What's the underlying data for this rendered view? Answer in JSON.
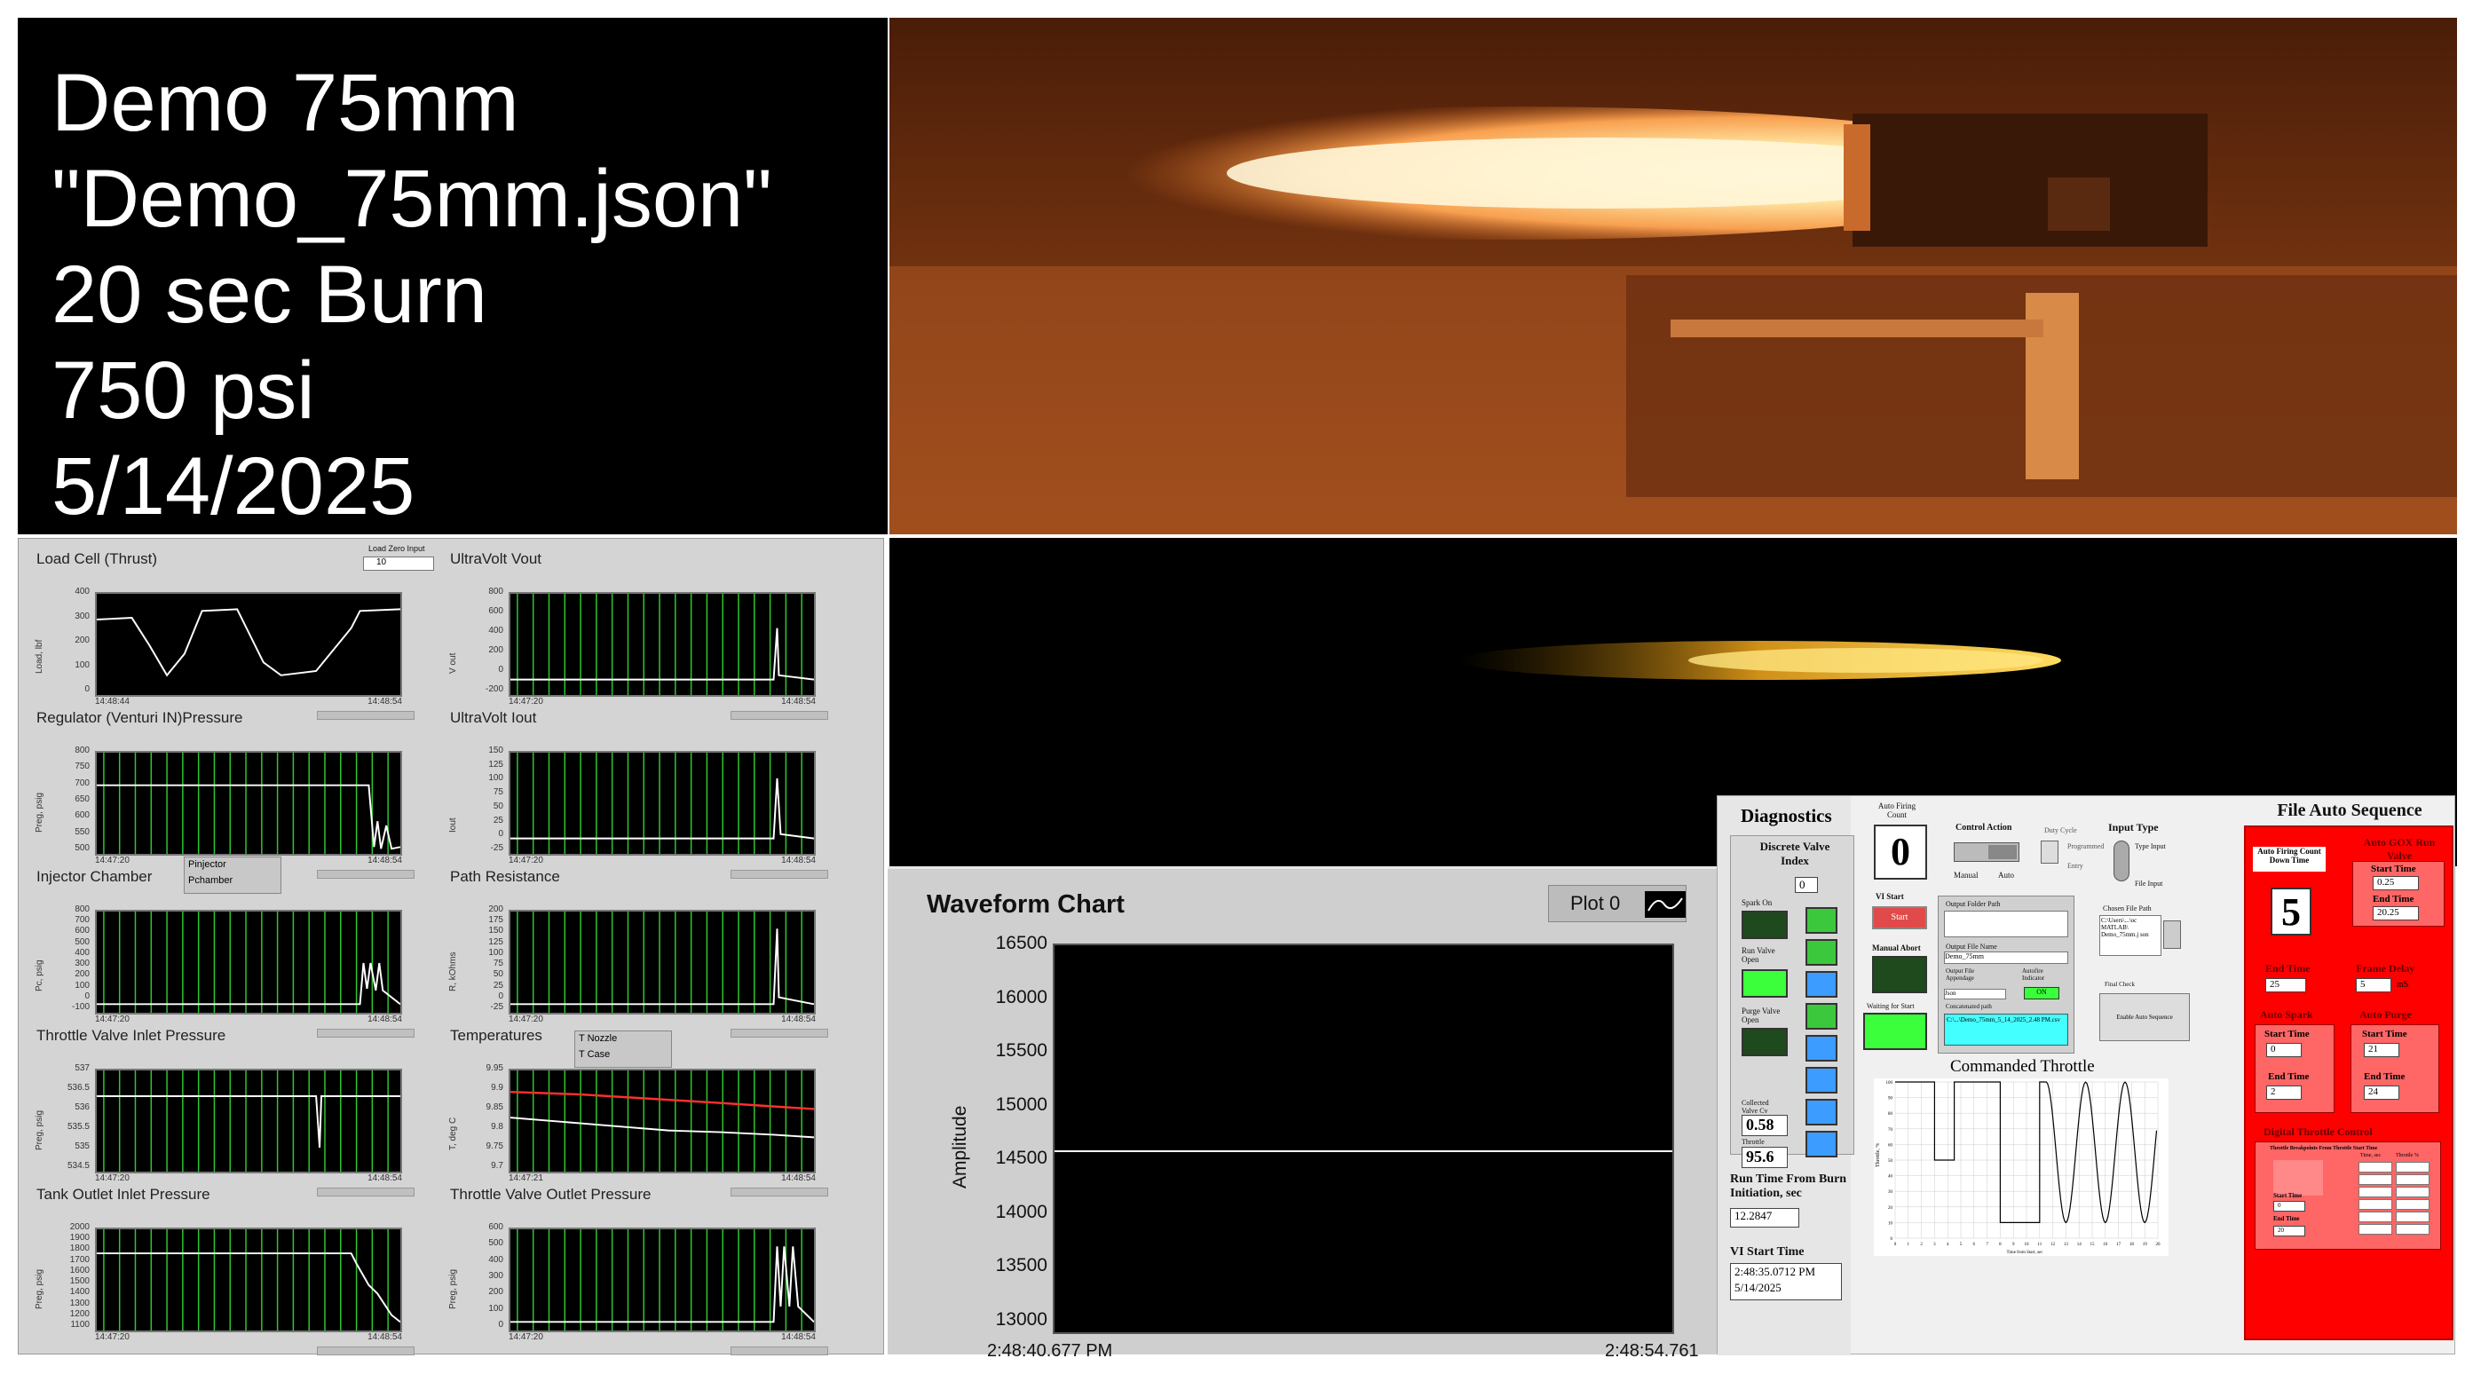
{
  "title_panel": {
    "line1": "Demo 75mm",
    "line2": "\"Demo_75mm.json\"",
    "line3": "20 sec Burn",
    "line4": "750 psi",
    "line5": "5/14/2025"
  },
  "graphs": [
    {
      "title": "Load Cell (Thrust)",
      "ylabel": "Load, lbf",
      "yticks": [
        "400",
        "300",
        "200",
        "100",
        "0"
      ],
      "x_start": "14:48:44",
      "x_end": "14:48:54"
    },
    {
      "title": "UltraVolt Vout",
      "ylabel": "V out",
      "yticks": [
        "800",
        "600",
        "400",
        "200",
        "0",
        "-200"
      ],
      "x_start": "14:47:20",
      "x_end": "14:48:54"
    },
    {
      "title": "Regulator (Venturi IN)Pressure",
      "ylabel": "Preg, psig",
      "yticks": [
        "800",
        "750",
        "700",
        "650",
        "600",
        "550",
        "500"
      ],
      "x_start": "14:47:20",
      "x_end": "14:48:54"
    },
    {
      "title": "UltraVolt Iout",
      "ylabel": "Iout",
      "yticks": [
        "150",
        "125",
        "100",
        "75",
        "50",
        "25",
        "0",
        "-25"
      ],
      "x_start": "14:47:20",
      "x_end": "14:48:54"
    },
    {
      "title": "Injector Chamber",
      "ylabel": "Pc, psig",
      "yticks": [
        "800",
        "700",
        "600",
        "500",
        "400",
        "300",
        "200",
        "100",
        "0",
        "-100"
      ],
      "x_start": "14:47:20",
      "x_end": "14:48:54"
    },
    {
      "title": "Path Resistance",
      "ylabel": "R, kOhms",
      "yticks": [
        "200",
        "175",
        "150",
        "125",
        "100",
        "75",
        "50",
        "25",
        "0",
        "-25"
      ],
      "x_start": "14:47:20",
      "x_end": "14:48:54"
    },
    {
      "title": "Throttle Valve Inlet Pressure",
      "ylabel": "Preg, psig",
      "yticks": [
        "537",
        "536.5",
        "536",
        "535.5",
        "535",
        "534.5"
      ],
      "x_start": "14:47:20",
      "x_end": "14:48:54"
    },
    {
      "title": "Temperatures",
      "ylabel": "T, deg C",
      "yticks": [
        "9.95",
        "9.9",
        "9.85",
        "9.8",
        "9.75",
        "9.7"
      ],
      "x_start": "14:47:21",
      "x_end": "14:48:54"
    },
    {
      "title": "Tank Outlet Inlet Pressure",
      "ylabel": "Preg, psig",
      "yticks": [
        "2000",
        "1900",
        "1800",
        "1700",
        "1600",
        "1500",
        "1400",
        "1300",
        "1200",
        "1100"
      ],
      "x_start": "14:47:20",
      "x_end": "14:48:54"
    },
    {
      "title": "Throttle Valve Outlet Pressure",
      "ylabel": "Preg, psig",
      "yticks": [
        "600",
        "500",
        "400",
        "300",
        "200",
        "100",
        "0"
      ],
      "x_start": "14:47:20",
      "x_end": "14:48:54"
    }
  ],
  "load_zero_input_label": "Load Zero Input",
  "load_zero_input_value": "10",
  "injector_legend": [
    "Pinjector",
    "Pchamber"
  ],
  "temp_legend": [
    "T Nozzle",
    "T Case"
  ],
  "waveform": {
    "title": "Waveform Chart",
    "plot_label": "Plot 0",
    "ylabel": "Amplitude",
    "yticks": [
      "16500",
      "16000",
      "15500",
      "15000",
      "14500",
      "14000",
      "13500",
      "13000"
    ],
    "x_start": "2:48:40.677 PM",
    "x_end": "2:48:54.761"
  },
  "diagnostics": {
    "title": "Diagnostics",
    "discrete_valve_index_label": "Discrete Valve Index",
    "discrete_valve_index_value": "0",
    "spark_on": "Spark On",
    "run_valve_open": "Run Valve Open",
    "purge_valve_open": "Purge Valve Open",
    "collected_valve_label": "Collected Valve Cv",
    "collected_valve_value": "0.58",
    "throttle_label": "Throttle",
    "throttle_value": "95.6",
    "auto_firing_count_label": "Auto Firing Count",
    "auto_firing_count_value": "0",
    "vi_start_label": "VI Start",
    "start_button": "Start",
    "manual_abort": "Manual Abort",
    "waiting_for_start": "Waiting for Start",
    "control_action": "Control Action",
    "manual": "Manual",
    "auto": "Auto",
    "duty_cycle": "Duty Cycle",
    "programmed": "Programmed",
    "entry": "Entry",
    "input_type": "Input Type",
    "type_input": "Type Input",
    "file_input": "File Input",
    "output_folder_path": "Output Folder Path",
    "output_file_name_label": "Output File Name",
    "output_file_name_value": "Demo_75mm",
    "output_file_appendage": "Output File Appendage",
    "autofire_indicator": "Autofire Indicator",
    "json_value": "Json",
    "on_value": "ON",
    "concatenated_path": "Concatenated path",
    "concatenated_value": "C:\\...\\Demo_75mm_5_14_2025_2.48 PM.csv",
    "chosen_file_path": "Chosen File Path",
    "chosen_file_value": "C:\\Users\\...\\oc MATLAB\\ Demo_75mm.j son",
    "final_check": "Final Check",
    "enable_auto_sequence": "Enable Auto Sequence",
    "run_time_label": "Run Time From Burn Initiation, sec",
    "run_time_value": "12.2847",
    "vi_start_time_label": "VI Start Time",
    "vi_start_time_value1": "2:48:35.0712 PM",
    "vi_start_time_value2": "5/14/2025"
  },
  "commanded_throttle": {
    "title": "Commanded Throttle",
    "ylabel": "Throttle, %",
    "xlabel": "Time from Start, sec",
    "yticks": [
      "100",
      "90",
      "80",
      "70",
      "60",
      "50",
      "40",
      "30",
      "20",
      "10",
      "0"
    ],
    "xticks": [
      "0",
      "1",
      "2",
      "3",
      "4",
      "5",
      "6",
      "7",
      "8",
      "9",
      "10",
      "11",
      "12",
      "13",
      "14",
      "15",
      "16",
      "17",
      "18",
      "19",
      "20"
    ]
  },
  "file_auto_sequence": {
    "title": "File Auto Sequence",
    "countdown_label": "Auto Firing Count Down Time",
    "countdown_value": "5",
    "gox_label": "Auto GOX Run Valve",
    "gox_start_label": "Start Time",
    "gox_start_value": "0.25",
    "gox_end_label": "End Time",
    "gox_end_value": "20.25",
    "end_time_label": "End Time",
    "end_time_value": "25",
    "frame_delay_label": "Frame Delay",
    "frame_delay_value": "5",
    "frame_delay_unit": "mS",
    "auto_spark": "Auto Spark",
    "spark_start_label": "Start Time",
    "spark_start_value": "0",
    "spark_end_label": "End Time",
    "spark_end_value": "2",
    "auto_purge": "Auto Purge",
    "purge_start_label": "Start Time",
    "purge_start_value": "21",
    "purge_end_label": "End Time",
    "purge_end_value": "24",
    "digital_throttle": "Digital Throttle Control",
    "throttle_breakpoints": "Throttle Breakpoints From Throttle Start Time",
    "time_sec": "Time, sec",
    "throttle_pct": "Throttle %",
    "start_time_label": "Start Time",
    "start_time_value": "0",
    "end_time2_label": "End Time",
    "end_time2_value": "20"
  }
}
